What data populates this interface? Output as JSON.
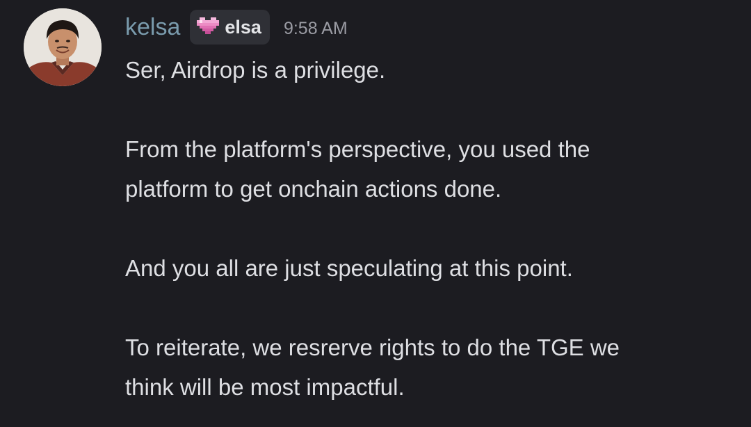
{
  "message": {
    "username": "kelsa",
    "tag": {
      "icon": "pink-pixel-heart-icon",
      "label": "elsa",
      "icon_color": "#f2a7d4"
    },
    "timestamp": "9:58 AM",
    "lines": [
      "Ser, Airdrop is a privilege.",
      "From the platform's perspective, you used the",
      "platform to get onchain actions done.",
      "And you all are just speculating at this point.",
      "To reiterate, we resrerve rights to do the TGE we",
      "think will be most impactful."
    ]
  },
  "colors": {
    "background": "#1c1c21",
    "username": "#7a9bad",
    "text": "#dedfe3",
    "timestamp": "#9b9ca4",
    "tag_bg": "#2f3036"
  }
}
